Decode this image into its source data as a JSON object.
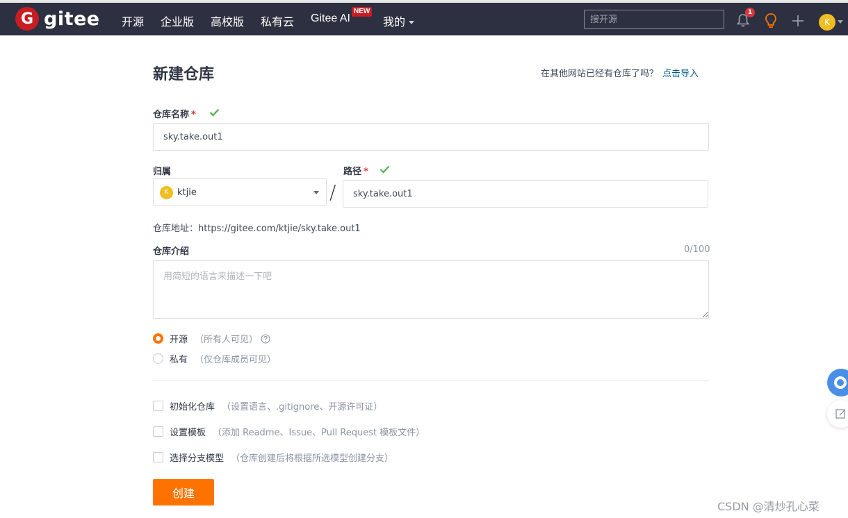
{
  "nav": {
    "logo_letter": "G",
    "logo_text": "gitee",
    "items": [
      "开源",
      "企业版",
      "高校版",
      "私有云",
      "Gitee AI",
      "我的"
    ],
    "new_badge": "NEW",
    "search_placeholder": "搜开源",
    "notification_count": "1",
    "avatar_letter": "K"
  },
  "form": {
    "title": "新建仓库",
    "import_hint": "在其他网站已经有仓库了吗？",
    "import_link": "点击导入",
    "name_label": "仓库名称",
    "required_mark": "*",
    "name_value": "sky.take.out1",
    "owner_label": "归属",
    "owner_avatar_letter": "K",
    "owner_name": "ktjie",
    "path_label": "路径",
    "path_separator": "/",
    "path_value": "sky.take.out1",
    "repo_url": "仓库地址：https://gitee.com/ktjie/sky.take.out1",
    "desc_label": "仓库介绍",
    "desc_counter": "0/100",
    "desc_placeholder": "用简短的语言来描述一下吧",
    "visibility": [
      {
        "label": "开源",
        "hint": "（所有人可见）",
        "selected": true
      },
      {
        "label": "私有",
        "hint": "（仅仓库成员可见）",
        "selected": false
      }
    ],
    "options": [
      {
        "label": "初始化仓库",
        "hint": "（设置语言、.gitignore、开源许可证）"
      },
      {
        "label": "设置模板",
        "hint": "（添加 Readme、Issue、Pull Request 模板文件）"
      },
      {
        "label": "选择分支模型",
        "hint": "（仓库创建后将根据所选模型创建分支）"
      }
    ],
    "submit_label": "创建"
  },
  "watermark": "CSDN @清炒孔心菜",
  "colors": {
    "nav_bg": "#2c3040",
    "brand_red": "#c71d23",
    "accent_orange": "#fe7300",
    "link": "#005980",
    "success_green": "#4caf50"
  }
}
